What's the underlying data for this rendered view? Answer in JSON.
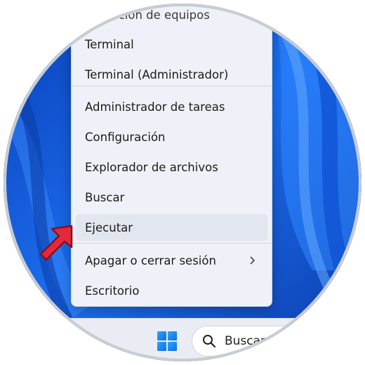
{
  "menu": {
    "items": [
      {
        "label": "...stración de equipos",
        "partial": true
      },
      {
        "label": "Terminal"
      },
      {
        "label": "Terminal (Administrador)"
      },
      {
        "label": "Administrador de tareas"
      },
      {
        "label": "Configuración"
      },
      {
        "label": "Explorador de archivos"
      },
      {
        "label": "Buscar"
      },
      {
        "label": "Ejecutar",
        "highlighted": true
      },
      {
        "label": "Apagar o cerrar sesión",
        "has_submenu": true
      },
      {
        "label": "Escritorio"
      }
    ]
  },
  "taskbar": {
    "start_icon": "windows-logo-icon",
    "search": {
      "icon": "search-icon",
      "label": "Buscar"
    }
  },
  "annotation": {
    "icon": "red-arrow-icon",
    "points_to": "Ejecutar"
  },
  "colors": {
    "accent_arrow": "#e5283b",
    "wallpaper": "#1a5fe0",
    "menu_bg": "#eef1f7",
    "windows_logo": "#1a8bf0"
  }
}
